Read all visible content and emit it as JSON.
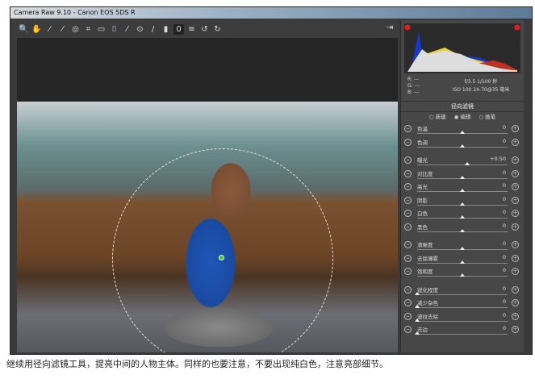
{
  "window": {
    "title": "Camera Raw 9.10 - Canon EOS 5DS R"
  },
  "toolbar": {
    "tools": [
      {
        "icon": "zoom-icon",
        "glyph": "🔍"
      },
      {
        "icon": "hand-icon",
        "glyph": "✋"
      },
      {
        "icon": "white-balance-icon",
        "glyph": "⁄"
      },
      {
        "icon": "color-sampler-icon",
        "glyph": "⁄"
      },
      {
        "icon": "target-adjust-icon",
        "glyph": "◎"
      },
      {
        "icon": "crop-icon",
        "glyph": "⌗"
      },
      {
        "icon": "straighten-icon",
        "glyph": "▭"
      },
      {
        "icon": "transform-icon",
        "glyph": "⌷"
      },
      {
        "icon": "spot-removal-icon",
        "glyph": "⁄"
      },
      {
        "icon": "red-eye-icon",
        "glyph": "⊙"
      },
      {
        "icon": "brush-icon",
        "glyph": "/"
      },
      {
        "icon": "graduated-filter-icon",
        "glyph": "▮"
      },
      {
        "icon": "radial-filter-icon",
        "glyph": "0",
        "active": true
      },
      {
        "icon": "preferences-icon",
        "glyph": "≡"
      },
      {
        "icon": "rotate-ccw-icon",
        "glyph": "↺"
      },
      {
        "icon": "rotate-cw-icon",
        "glyph": "↻"
      }
    ],
    "export_icon": "open-external-icon"
  },
  "panel": {
    "rgb": {
      "r": "R:  ---",
      "g": "G:  ---",
      "b": "B:  ---"
    },
    "exif_line1": "f/3.5   1/100 秒",
    "exif_line2": "ISO 100   24-70@35 毫米",
    "title": "径向滤镜",
    "modes": [
      {
        "label": "新建",
        "selected": false
      },
      {
        "label": "编辑",
        "selected": true
      },
      {
        "label": "画笔",
        "selected": false
      }
    ],
    "sliders": [
      {
        "label": "色温",
        "value": "0",
        "pos": 0.5
      },
      {
        "label": "色调",
        "value": "0",
        "pos": 0.5
      },
      {
        "label": "曝光",
        "value": "+0.50",
        "pos": 0.55
      },
      {
        "label": "对比度",
        "value": "0",
        "pos": 0.5
      },
      {
        "label": "高光",
        "value": "0",
        "pos": 0.5
      },
      {
        "label": "阴影",
        "value": "0",
        "pos": 0.5
      },
      {
        "label": "白色",
        "value": "0",
        "pos": 0.5
      },
      {
        "label": "黑色",
        "value": "0",
        "pos": 0.5
      },
      {
        "label": "清晰度",
        "value": "0",
        "pos": 0.5
      },
      {
        "label": "去除薄雾",
        "value": "0",
        "pos": 0.5
      },
      {
        "label": "饱和度",
        "value": "0",
        "pos": 0.5
      },
      {
        "label": "锐化程度",
        "value": "0",
        "pos": 0
      },
      {
        "label": "减少杂色",
        "value": "0",
        "pos": 0
      },
      {
        "label": "波纹去除",
        "value": "0",
        "pos": 0
      },
      {
        "label": "去边",
        "value": "0",
        "pos": 0
      }
    ]
  },
  "caption": "继续用径向滤镜工具，提亮中间的人物主体。同样的也要注意，不要出现纯白色，注意亮部细节。"
}
